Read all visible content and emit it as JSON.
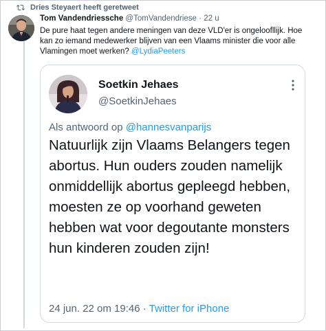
{
  "retweet": {
    "label": "Dries Steyaert heeft geretweet",
    "icon": "retweet-icon"
  },
  "tweet": {
    "author_name": "Tom Vandendriessche",
    "author_handle": "@TomVandendriese",
    "separator": "·",
    "time": "22 u",
    "text_part1": "De pure haat tegen andere meningen van deze VLD'er is ongeloofllijk. Hoe kan zo iemand medewerker blijven van een Vlaams minister die voor alle Vlamingen moet werken? ",
    "mention": "@LydiaPeeters"
  },
  "quote": {
    "author_name": "Soetkin Jehaes",
    "author_handle": "@SoetkinJehaes",
    "reply_prefix": "Als antwoord op ",
    "reply_mention": "@hannesvanparijs",
    "body": "Natuurlijk zijn Vlaams Belangers tegen abortus. Hun ouders zouden namelijk onmiddellijk abortus gepleegd hebben, moesten ze op voorhand geweten hebben wat voor degoutante monsters hun kinderen zouden zijn!",
    "date": "24 jun. 22 om 19:46",
    "dot": " · ",
    "source": "Twitter for iPhone"
  },
  "colors": {
    "link": "#1d9bf0",
    "secondary_text": "#536471",
    "primary_text": "#0f1419",
    "border": "#cfd9de"
  }
}
